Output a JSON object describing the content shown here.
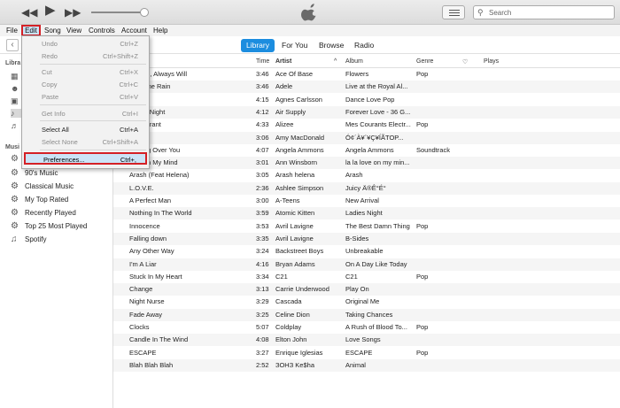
{
  "search": {
    "placeholder": "Search"
  },
  "menubar": [
    "File",
    "Edit",
    "Song",
    "View",
    "Controls",
    "Account",
    "Help"
  ],
  "tabs": [
    {
      "label": "Library",
      "active": true
    },
    {
      "label": "For You",
      "active": false
    },
    {
      "label": "Browse",
      "active": false
    },
    {
      "label": "Radio",
      "active": false
    }
  ],
  "sidebar": {
    "library_head": "Libra",
    "music_head": "Musi",
    "playlists": [
      "90's Music",
      "Classical Music",
      "My Top Rated",
      "Recently Played",
      "Top 25 Most Played",
      "Spotify"
    ]
  },
  "columns": {
    "time": "Time",
    "artist": "Artist",
    "album": "Album",
    "genre": "Genre",
    "plays": "Plays"
  },
  "songs": [
    {
      "name": "s Have, Always Will",
      "time": "3:46",
      "artist": "Ace Of Base",
      "album": "Flowers",
      "genre": "Pop"
    },
    {
      "name": "e To The Rain",
      "time": "3:46",
      "artist": "Adele",
      "album": "Live at the Royal Al...",
      "genre": ""
    },
    {
      "name": "e Me",
      "time": "4:15",
      "artist": "Agnes Carlsson",
      "album": "Dance Love Pop",
      "genre": ""
    },
    {
      "name": "Is The Night",
      "time": "4:12",
      "artist": "Air Supply",
      "album": "Forever Love - 36 G...",
      "genre": ""
    },
    {
      "name": "re-Courant",
      "time": "4:33",
      "artist": "Alizee",
      "album": "Mes Courants Electr...",
      "genre": "Pop"
    },
    {
      "name": "the life",
      "time": "3:06",
      "artist": "Amy MacDonald",
      "album": "Ó¢´À¥´¥Ç¥ÍÃTOP...",
      "genre": ""
    },
    {
      "name": "Getting Over You",
      "time": "4:07",
      "artist": "Angela Ammons",
      "album": "Angela Ammons",
      "genre": "Soundtrack"
    },
    {
      "name": "ove On My Mind",
      "time": "3:01",
      "artist": "Ann Winsborn",
      "album": "la la love on my min...",
      "genre": ""
    },
    {
      "name": "Arash (Feat Helena)",
      "time": "3:05",
      "artist": "Arash helena",
      "album": "Arash",
      "genre": ""
    },
    {
      "name": "L.O.V.E.",
      "time": "2:36",
      "artist": "Ashlee Simpson",
      "album": "Juicy Ä®Ê°É°",
      "genre": ""
    },
    {
      "name": "A Perfect Man",
      "time": "3:00",
      "artist": "A-Teens",
      "album": "New Arrival",
      "genre": ""
    },
    {
      "name": "Nothing In The World",
      "time": "3:59",
      "artist": "Atomic Kitten",
      "album": "Ladies Night",
      "genre": ""
    },
    {
      "name": "Innocence",
      "time": "3:53",
      "artist": "Avril Lavigne",
      "album": "The Best Damn Thing",
      "genre": "Pop"
    },
    {
      "name": "Falling down",
      "time": "3:35",
      "artist": "Avril Lavigne",
      "album": "B-Sides",
      "genre": ""
    },
    {
      "name": "Any Other Way",
      "time": "3:24",
      "artist": "Backstreet Boys",
      "album": "Unbreakable",
      "genre": ""
    },
    {
      "name": "I'm A Liar",
      "time": "4:16",
      "artist": "Bryan Adams",
      "album": "On A Day Like Today",
      "genre": ""
    },
    {
      "name": "Stuck In My Heart",
      "time": "3:34",
      "artist": "C21",
      "album": "C21",
      "genre": "Pop"
    },
    {
      "name": "Change",
      "time": "3:13",
      "artist": "Carrie Underwood",
      "album": "Play On",
      "genre": ""
    },
    {
      "name": "Night Nurse",
      "time": "3:29",
      "artist": "Cascada",
      "album": "Original Me",
      "genre": ""
    },
    {
      "name": "Fade Away",
      "time": "3:25",
      "artist": "Celine Dion",
      "album": "Taking Chances",
      "genre": ""
    },
    {
      "name": "Clocks",
      "time": "5:07",
      "artist": "Coldplay",
      "album": "A Rush of Blood To...",
      "genre": "Pop"
    },
    {
      "name": "Candle In The Wind",
      "time": "4:08",
      "artist": "Elton John",
      "album": "Love Songs",
      "genre": ""
    },
    {
      "name": "ESCAPE",
      "time": "3:27",
      "artist": "Enrique Iglesias",
      "album": "ESCAPE",
      "genre": "Pop"
    },
    {
      "name": "Blah Blah Blah",
      "time": "2:52",
      "artist": "ЗОНЗ Ke$ha",
      "album": "Animal",
      "genre": ""
    }
  ],
  "edit_menu": [
    {
      "label": "Undo",
      "shortcut": "Ctrl+Z",
      "enabled": false
    },
    {
      "label": "Redo",
      "shortcut": "Ctrl+Shift+Z",
      "enabled": false
    },
    {
      "label": "Cut",
      "shortcut": "Ctrl+X",
      "enabled": false
    },
    {
      "label": "Copy",
      "shortcut": "Ctrl+C",
      "enabled": false
    },
    {
      "label": "Paste",
      "shortcut": "Ctrl+V",
      "enabled": false
    },
    {
      "label": "Get Info",
      "shortcut": "Ctrl+I",
      "enabled": false
    },
    {
      "label": "Select All",
      "shortcut": "Ctrl+A",
      "enabled": true
    },
    {
      "label": "Select None",
      "shortcut": "Ctrl+Shift+A",
      "enabled": false
    },
    {
      "label": "Preferences...",
      "shortcut": "Ctrl+,",
      "enabled": true,
      "highlighted": true
    }
  ]
}
